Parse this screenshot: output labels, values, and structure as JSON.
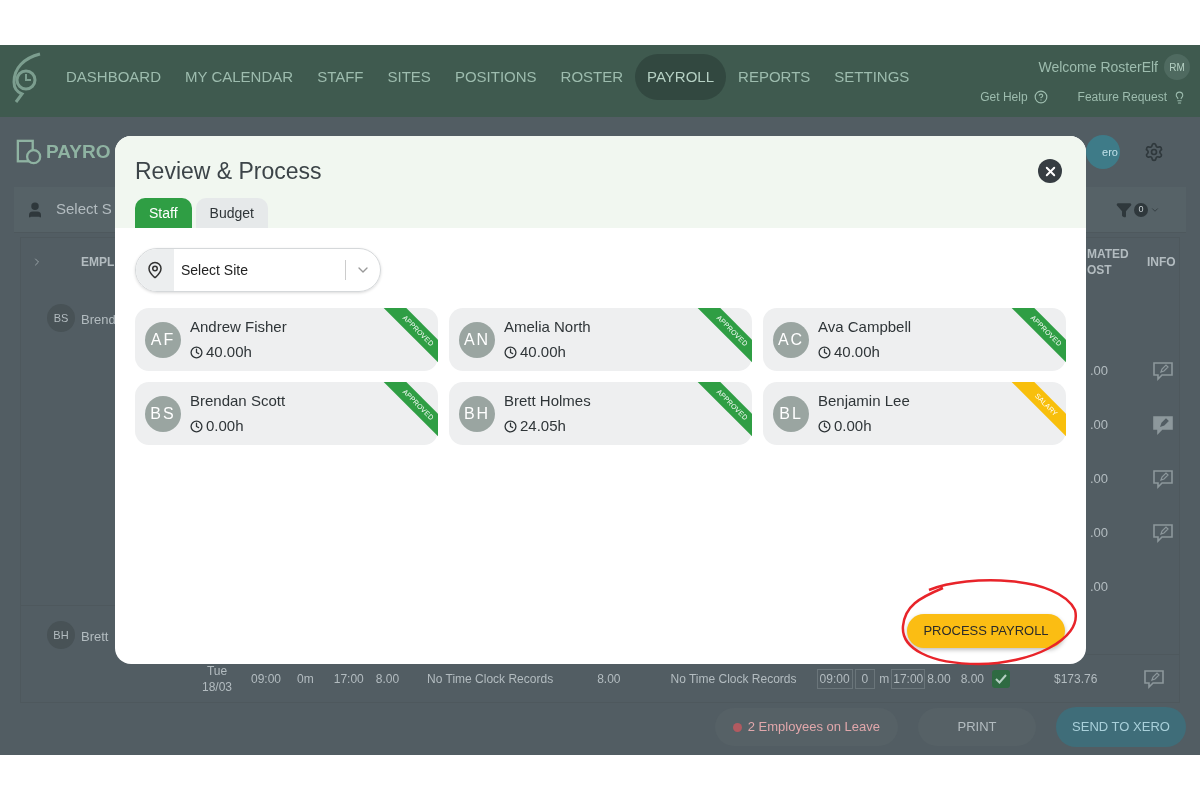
{
  "nav": {
    "items": [
      {
        "label": "DASHBOARD",
        "selected": false
      },
      {
        "label": "MY CALENDAR",
        "selected": false
      },
      {
        "label": "STAFF",
        "selected": false
      },
      {
        "label": "SITES",
        "selected": false
      },
      {
        "label": "POSITIONS",
        "selected": false
      },
      {
        "label": "ROSTER",
        "selected": false
      },
      {
        "label": "PAYROLL",
        "selected": true
      },
      {
        "label": "REPORTS",
        "selected": false
      },
      {
        "label": "SETTINGS",
        "selected": false
      }
    ],
    "welcome": "Welcome RosterElf",
    "avatar": "RM",
    "help": "Get Help",
    "feature": "Feature Request"
  },
  "page": {
    "title": "PAYRO",
    "xero_button": "ero",
    "site_filter": "Select S",
    "filter_count": "0"
  },
  "table": {
    "columns": [
      "EMPL",
      "MATED OST",
      "INFO"
    ],
    "employees": [
      {
        "initials": "BS",
        "name": "Brend"
      },
      {
        "initials": "BH",
        "name": "Brett"
      }
    ],
    "cost_rows": [
      {
        "kind": "note",
        "cost": ".00"
      },
      {
        "kind": "filled_note",
        "cost": ".00"
      },
      {
        "kind": "note",
        "cost": ".00"
      },
      {
        "kind": "note",
        "cost": ".00"
      },
      {
        "kind": "plain",
        "cost": ".00"
      }
    ],
    "day_row": {
      "day": "Tue",
      "date": "18/03",
      "start": "09:00",
      "break": "0m",
      "end": "17:00",
      "hours": "8.00",
      "clock_1": "No Time Clock Records",
      "hours_2": "8.00",
      "clock_2": "No Time Clock Records",
      "in_start": "09:00",
      "in_break": "0",
      "in_unit": "m",
      "in_end": "17:00",
      "in_hours": "8.00",
      "total": "8.00",
      "approved": true,
      "cost": "$173.76",
      "kind": "note"
    }
  },
  "footer": {
    "leave": "2 Employees on Leave",
    "print": "PRINT",
    "send": "SEND TO XERO"
  },
  "modal": {
    "title": "Review & Process",
    "tabs": [
      {
        "label": "Staff",
        "selected": true
      },
      {
        "label": "Budget",
        "selected": false
      }
    ],
    "site_select": {
      "placeholder": "Select Site"
    },
    "staff": [
      {
        "initials": "AF",
        "name": "Andrew Fisher",
        "hours": "40.00h",
        "status": "APPROVED",
        "color": "#2f9e44"
      },
      {
        "initials": "AN",
        "name": "Amelia North",
        "hours": "40.00h",
        "status": "APPROVED",
        "color": "#2f9e44"
      },
      {
        "initials": "AC",
        "name": "Ava Campbell",
        "hours": "40.00h",
        "status": "APPROVED",
        "color": "#2f9e44"
      },
      {
        "initials": "BS",
        "name": "Brendan Scott",
        "hours": "0.00h",
        "status": "APPROVED",
        "color": "#2f9e44"
      },
      {
        "initials": "BH",
        "name": "Brett Holmes",
        "hours": "24.05h",
        "status": "APPROVED",
        "color": "#2f9e44"
      },
      {
        "initials": "BL",
        "name": "Benjamin Lee",
        "hours": "0.00h",
        "status": "SALARY",
        "color": "#f8bf0c"
      }
    ],
    "process_button": "PROCESS PAYROLL"
  }
}
